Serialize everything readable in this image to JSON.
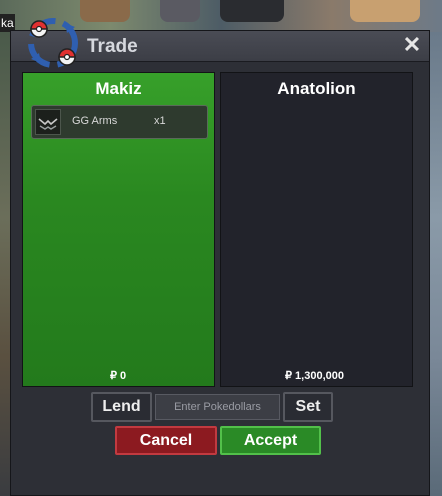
{
  "window": {
    "title": "Trade",
    "close_icon": "close-icon",
    "logo_icon": "pokeball-swap-icon"
  },
  "background": {
    "partial_label": "ka"
  },
  "left_panel": {
    "name": "Makiz",
    "items": [
      {
        "name": "GG Arms",
        "qty": "x1",
        "icon": "gg-arms-icon"
      }
    ],
    "money": "₽ 0",
    "color": "#2a8820"
  },
  "right_panel": {
    "name": "Anatolion",
    "items": [],
    "money": "₽ 1,300,000",
    "color": "#22232b"
  },
  "controls": {
    "lend_label": "Lend",
    "pokedollars_placeholder": "Enter Pokedollars",
    "set_label": "Set",
    "cancel_label": "Cancel",
    "accept_label": "Accept"
  },
  "colors": {
    "cancel": "#8c1a20",
    "accept": "#2a8a26",
    "panel_bg": "#2d2f36"
  }
}
